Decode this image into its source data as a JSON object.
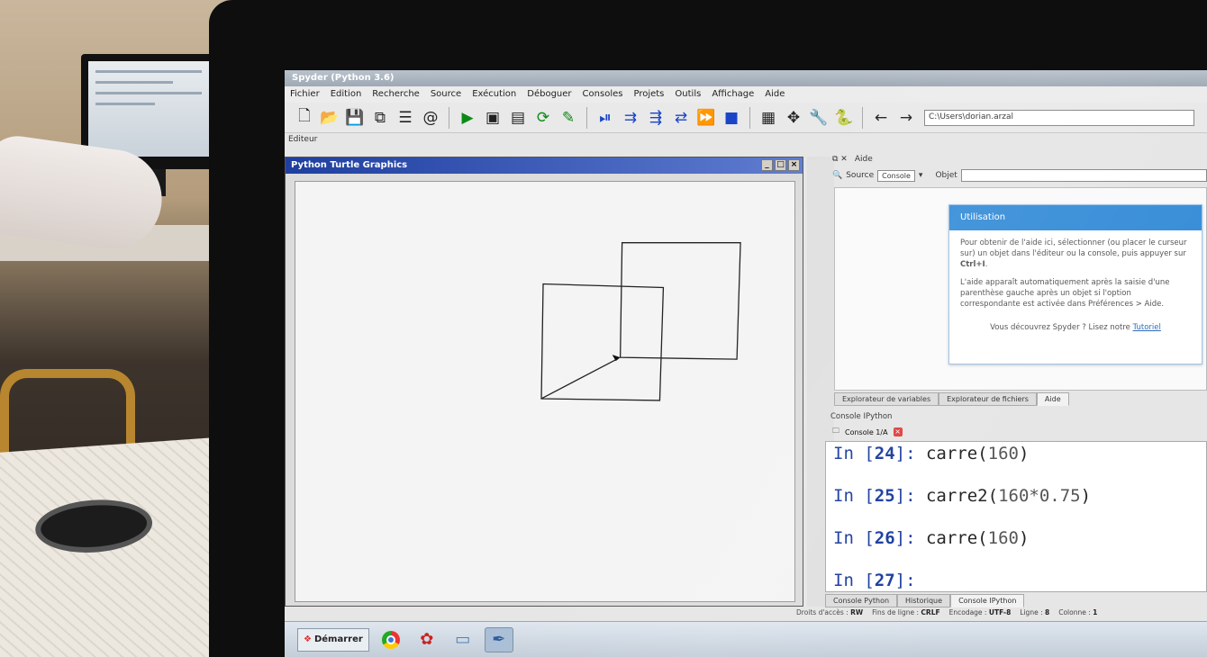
{
  "window": {
    "title": "Spyder (Python 3.6)"
  },
  "menu": [
    "Fichier",
    "Edition",
    "Recherche",
    "Source",
    "Exécution",
    "Déboguer",
    "Consoles",
    "Projets",
    "Outils",
    "Affichage",
    "Aide"
  ],
  "toolbar": {
    "path": "C:\\Users\\dorian.arzal"
  },
  "editor": {
    "label": "Editeur"
  },
  "turtle": {
    "title": "Python Turtle Graphics",
    "buttons": {
      "minimize": "_",
      "maximize": "□",
      "close": "×"
    }
  },
  "help_pane": {
    "header": "Aide",
    "source_label": "Source",
    "source_value": "Console",
    "object_label": "Objet",
    "card": {
      "title": "Utilisation",
      "p1_pre": "Pour obtenir de l'aide ici, sélectionner (ou placer le curseur sur) un objet dans l'éditeur ou la console, puis appuyer sur ",
      "p1_key": "Ctrl+I",
      "p1_post": ".",
      "p2": "L'aide apparaît automatiquement après la saisie d'une parenthèse gauche après un objet si l'option correspondante est activée dans Préférences > Aide.",
      "footer_text": "Vous découvrez Spyder ? Lisez notre ",
      "footer_link": "Tutoriel"
    },
    "tabs": [
      "Explorateur de variables",
      "Explorateur de fichiers",
      "Aide"
    ]
  },
  "console": {
    "header": "Console IPython",
    "tab": "Console 1/A",
    "lines": [
      {
        "prompt": "In [",
        "num": "24",
        "close": "]: ",
        "code": "carre(",
        "arg": "160",
        "end": ")"
      },
      {
        "prompt": "In [",
        "num": "25",
        "close": "]: ",
        "code": "carre2(",
        "arg": "160*0.75",
        "end": ")"
      },
      {
        "prompt": "In [",
        "num": "26",
        "close": "]: ",
        "code": "carre(",
        "arg": "160",
        "end": ")"
      },
      {
        "prompt": "In [",
        "num": "27",
        "close": "]: ",
        "code": "",
        "arg": "",
        "end": ""
      }
    ],
    "tabs": [
      "Console Python",
      "Historique",
      "Console IPython"
    ]
  },
  "status": {
    "rights_label": "Droits d'accès :",
    "rights": "RW",
    "eol_label": "Fins de ligne :",
    "eol": "CRLF",
    "enc_label": "Encodage :",
    "enc": "UTF-8",
    "line_label": "Ligne :",
    "line": "8",
    "col_label": "Colonne :",
    "col": "1"
  },
  "taskbar": {
    "start": "Démarrer"
  }
}
